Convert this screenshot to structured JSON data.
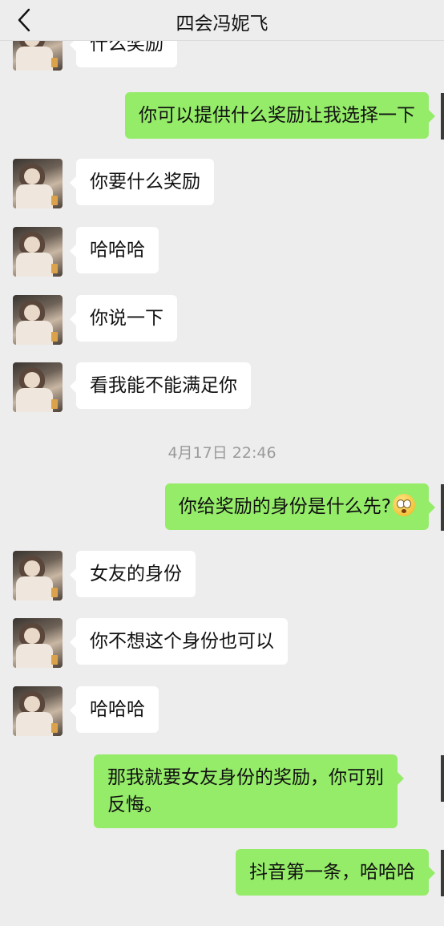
{
  "header": {
    "title": "四会冯妮飞",
    "back_icon": "chevron-left-icon"
  },
  "messages": [
    {
      "side": "in",
      "text": "什么奖励"
    },
    {
      "side": "out",
      "text": "你可以提供什么奖励让我选择一下"
    },
    {
      "side": "in",
      "text": "你要什么奖励"
    },
    {
      "side": "in",
      "text": "哈哈哈"
    },
    {
      "side": "in",
      "text": "你说一下"
    },
    {
      "side": "in",
      "text": "看我能不能满足你"
    },
    {
      "side": "time",
      "text": "4月17日 22:46"
    },
    {
      "side": "out",
      "text": "你给奖励的身份是什么先?",
      "emoji": "flushed-face-icon"
    },
    {
      "side": "in",
      "text": "女友的身份"
    },
    {
      "side": "in",
      "text": "你不想这个身份也可以"
    },
    {
      "side": "in",
      "text": "哈哈哈"
    },
    {
      "side": "out",
      "lines": [
        "那我就要女友身份的奖励，你可别",
        "反悔。"
      ]
    },
    {
      "side": "out",
      "text": "抖音第一条，哈哈哈"
    }
  ],
  "colors": {
    "background": "#ededed",
    "incoming_bubble": "#ffffff",
    "outgoing_bubble": "#95ec69",
    "timestamp_text": "#9a9a9a"
  }
}
